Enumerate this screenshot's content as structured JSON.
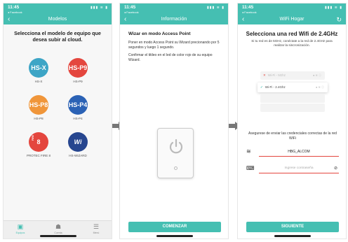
{
  "status_bar": {
    "time": "11:45",
    "carrier": "◂ Facebook",
    "signals": "▮▮▮ ≋ ▮"
  },
  "screen1": {
    "nav_title": "Modelos",
    "heading": "Selecciona el modelo de equipo que desea subir al cloud.",
    "models": [
      {
        "badge": "HS-X",
        "label": "HS-X",
        "color": "#3da5c6"
      },
      {
        "badge": "HS-P9",
        "label": "HS-P9",
        "color": "#e4463e"
      },
      {
        "badge": "HS-P8",
        "label": "HS-P8",
        "color": "#f0963a"
      },
      {
        "badge": "HS-P4",
        "label": "HS-P4",
        "color": "#2b62b5"
      },
      {
        "badge": "8",
        "label": "PROTEC FIRE 8",
        "color": "#e4463e"
      },
      {
        "badge": "Wi",
        "label": "HS-WIZARD",
        "color": "#27468f"
      }
    ],
    "tabs": [
      {
        "label": "Equipos",
        "icon": "devices-icon"
      },
      {
        "label": "Cuenta",
        "icon": "account-icon"
      },
      {
        "label": "Menú",
        "icon": "menu-icon"
      }
    ]
  },
  "screen2": {
    "nav_title": "Información",
    "title": "Wizar en modo Access Point",
    "instruction1": "Poner en modo Access Point su Wizard precionando por 5 segundos y luego 1 segundo.",
    "instruction2": "Confirmar el titileo en el led de color rojo de su equipo Wizard.",
    "button": "COMENZAR"
  },
  "screen3": {
    "nav_title": "WiFi Hogar",
    "title": "Selecciona una red Wifi de 2.4GHz",
    "subtitle": "Si tu red es de 5GHz, conéctate a la red de 2.4GHz para realizar la sincronización.",
    "wifi_options": [
      {
        "label": "Wi-Fi - 5Ghz",
        "state": "rejected"
      },
      {
        "label": "Wi-Fi - 2.4Ghz",
        "state": "selected"
      }
    ],
    "credentials_note": "Asegurese de enviar las credenciales correctas de la red WiFi",
    "ssid_value": "HBG_ALCOM",
    "password_placeholder": "Ingrese contraseña",
    "button": "SIGUIENTE"
  },
  "colors": {
    "accent": "#45bfb2",
    "error": "#e4463e",
    "arrow": "#777777"
  }
}
